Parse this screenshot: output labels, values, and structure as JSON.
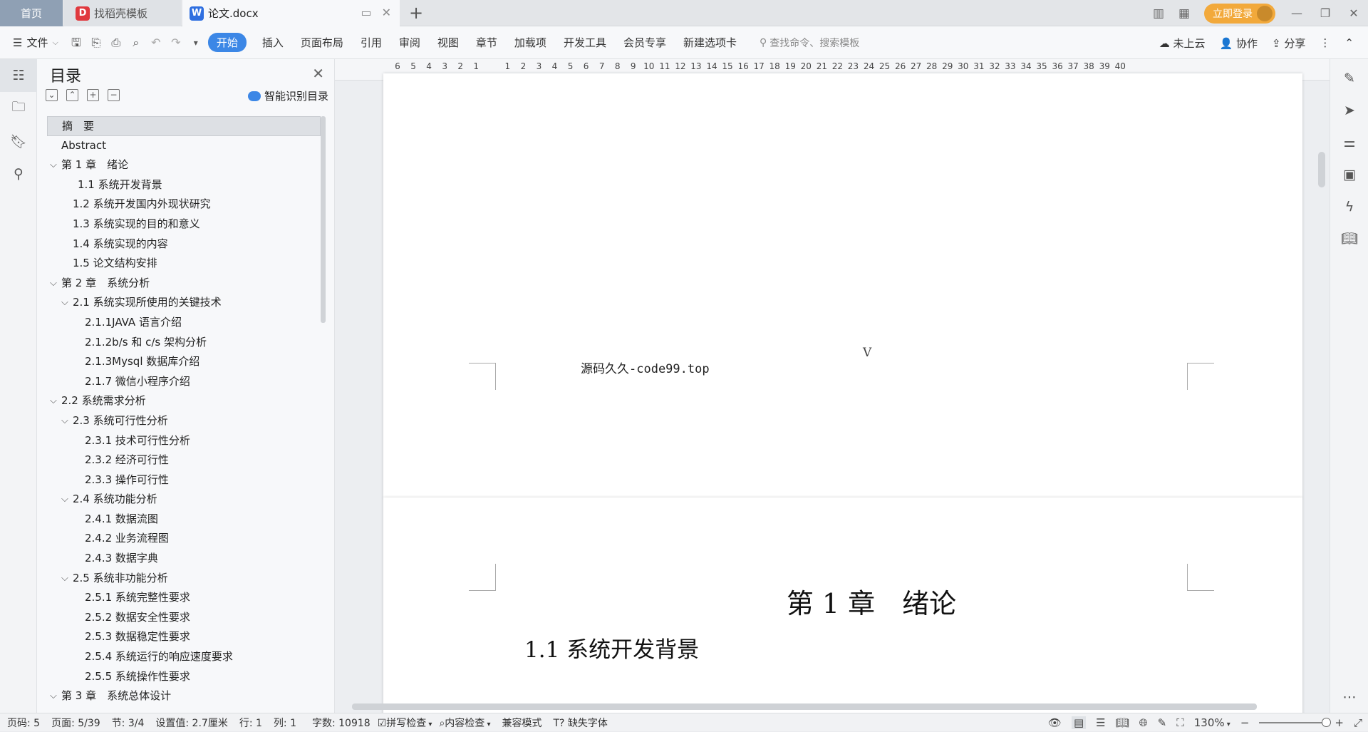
{
  "tabs": {
    "home": "首页",
    "templates": "找稻壳模板",
    "doc": "论文.docx"
  },
  "topright": {
    "login": "立即登录"
  },
  "menubar": {
    "file": "文件",
    "items": [
      "开始",
      "插入",
      "页面布局",
      "引用",
      "审阅",
      "视图",
      "章节",
      "加载项",
      "开发工具",
      "会员专享",
      "新建选项卡"
    ],
    "search_placeholder": "查找命令、搜索模板",
    "cloud": "未上云",
    "collab": "协作",
    "share": "分享"
  },
  "toc": {
    "title": "目录",
    "smart": "智能识别目录",
    "items": [
      {
        "text": "摘　要",
        "level": 0,
        "selected": true,
        "chev": false
      },
      {
        "text": "Abstract",
        "level": 0,
        "chev": false
      },
      {
        "text": "第 1 章　绪论",
        "level": 0,
        "chev": true
      },
      {
        "text": "1.1 系统开发背景",
        "level": 2,
        "chev": false
      },
      {
        "text": "1.2 系统开发国内外现状研究",
        "level": 1,
        "chev": false
      },
      {
        "text": "1.3 系统实现的目的和意义",
        "level": 1,
        "chev": false
      },
      {
        "text": "1.4 系统实现的内容",
        "level": 1,
        "chev": false
      },
      {
        "text": "1.5 论文结构安排",
        "level": 1,
        "chev": false
      },
      {
        "text": "第 2 章　系统分析",
        "level": 0,
        "chev": true
      },
      {
        "text": "2.1 系统实现所使用的关键技术",
        "level": 1,
        "chev": true
      },
      {
        "text": "2.1.1JAVA 语言介绍",
        "level": 2,
        "chev": false
      },
      {
        "text": "2.1.2b/s 和 c/s 架构分析",
        "level": 2,
        "chev": false
      },
      {
        "text": "2.1.3Mysql 数据库介绍",
        "level": 2,
        "chev": false
      },
      {
        "text": "2.1.7 微信小程序介绍",
        "level": 2,
        "chev": false
      },
      {
        "text": "2.2 系统需求分析",
        "level": 0,
        "chev": true
      },
      {
        "text": "2.3 系统可行性分析",
        "level": 1,
        "chev": true
      },
      {
        "text": "2.3.1 技术可行性分析",
        "level": 2,
        "chev": false
      },
      {
        "text": "2.3.2 经济可行性",
        "level": 2,
        "chev": false
      },
      {
        "text": "2.3.3 操作可行性",
        "level": 2,
        "chev": false
      },
      {
        "text": "2.4 系统功能分析",
        "level": 1,
        "chev": true
      },
      {
        "text": "2.4.1 数据流图",
        "level": 2,
        "chev": false
      },
      {
        "text": "2.4.2  业务流程图",
        "level": 2,
        "chev": false
      },
      {
        "text": "2.4.3 数据字典",
        "level": 2,
        "chev": false
      },
      {
        "text": "2.5  系统非功能分析",
        "level": 1,
        "chev": true
      },
      {
        "text": "2.5.1 系统完整性要求",
        "level": 2,
        "chev": false
      },
      {
        "text": "2.5.2 数据安全性要求",
        "level": 2,
        "chev": false
      },
      {
        "text": "2.5.3 数据稳定性要求",
        "level": 2,
        "chev": false
      },
      {
        "text": "2.5.4 系统运行的响应速度要求",
        "level": 2,
        "chev": false
      },
      {
        "text": "2.5.5 系统操作性要求",
        "level": 2,
        "chev": false
      },
      {
        "text": "第 3 章　系统总体设计",
        "level": 0,
        "chev": true
      }
    ]
  },
  "ruler": {
    "numbers": [
      "6",
      "5",
      "4",
      "3",
      "2",
      "1",
      "",
      "1",
      "2",
      "3",
      "4",
      "5",
      "6",
      "7",
      "8",
      "9",
      "10",
      "11",
      "12",
      "13",
      "14",
      "15",
      "16",
      "17",
      "18",
      "19",
      "20",
      "21",
      "22",
      "23",
      "24",
      "25",
      "26",
      "27",
      "28",
      "29",
      "30",
      "31",
      "32",
      "33",
      "34",
      "35",
      "36",
      "37",
      "38",
      "39",
      "40"
    ]
  },
  "document": {
    "watermark": "源码久久-code99.top",
    "page_roman": "V",
    "chapter": "第 1 章　绪论",
    "section": "1.1 系统开发背景"
  },
  "status": {
    "page_code": "页码: 5",
    "page": "页面: 5/39",
    "section": "节: 3/4",
    "setting": "设置值: 2.7厘米",
    "row": "行: 1",
    "col": "列: 1",
    "words": "字数: 10918",
    "spell": "拼写检查",
    "content_check": "内容检查",
    "compat": "兼容模式",
    "missing_font": "缺失字体",
    "zoom": "130%"
  },
  "zoom_level_percent": 130
}
